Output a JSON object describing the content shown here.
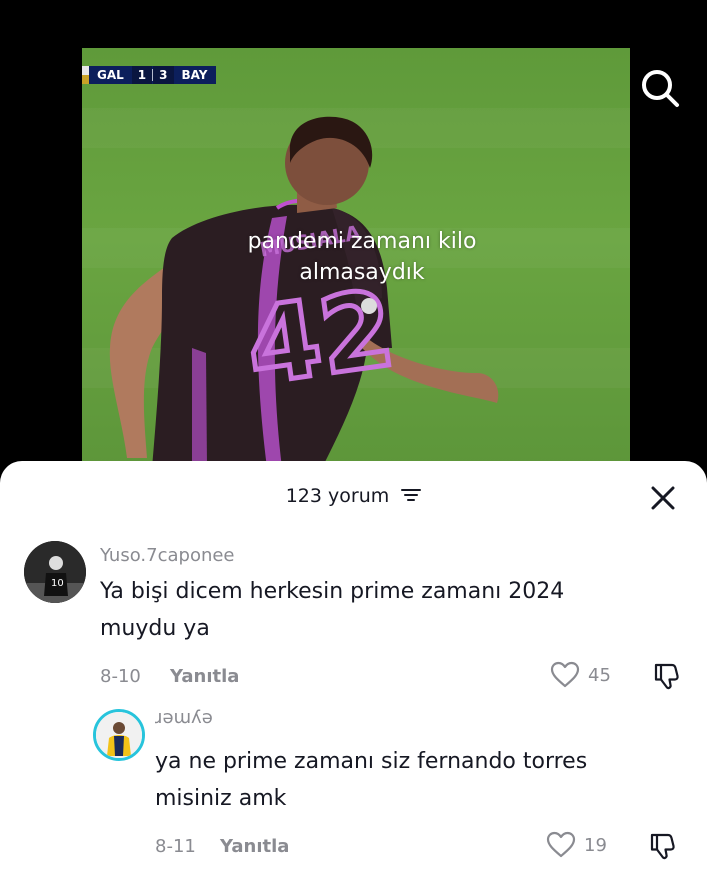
{
  "video": {
    "scorebug": {
      "home": "GAL",
      "home_score": "1",
      "away_score": "3",
      "away": "BAY"
    },
    "jersey_number": "42",
    "jersey_name": "MUSIALA",
    "caption": "pandemi zamanı kilo almasaydık"
  },
  "search": {
    "icon": "search-icon"
  },
  "comments_sheet": {
    "title": "123 yorum",
    "filter_icon": "filter-icon",
    "close_icon": "close-icon",
    "comments": [
      {
        "username": "Yuso.7caponee",
        "text_line1": "Ya bişi dicem herkesin prime zamanı 2024",
        "text_line2": "muydu ya",
        "date": "8-10",
        "reply_label": "Yanıtla",
        "likes": "45"
      },
      {
        "username": "ɹəɯʎə",
        "text_line1": "ya ne prime zamanı siz fernando torres",
        "text_line2": "misiniz amk",
        "date": "8-11",
        "reply_label": "Yanıtla",
        "likes": "19"
      }
    ]
  },
  "colors": {
    "sheet_bg": "#ffffff",
    "text_primary": "#161823",
    "text_secondary": "#8a8b91",
    "scorebug": "#0c1f5c",
    "jersey_accent": "#c04fd0"
  }
}
